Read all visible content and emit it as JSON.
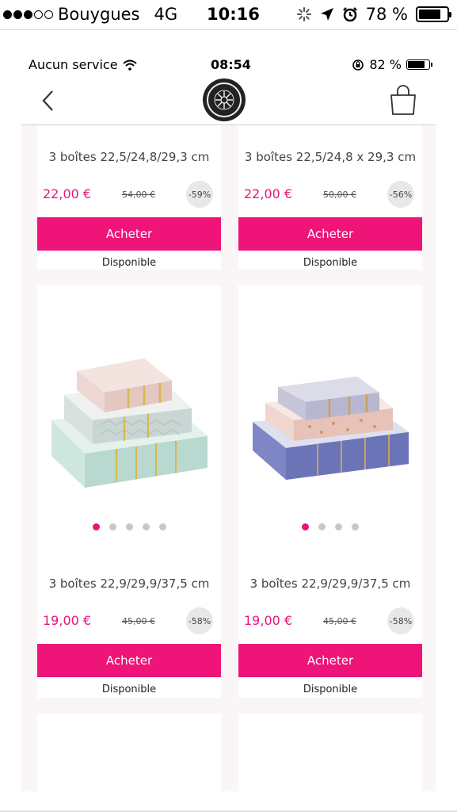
{
  "outer_status": {
    "carrier": "Bouygues",
    "network": "4G",
    "time": "10:16",
    "battery": "78 %",
    "battery_level": 0.78
  },
  "inner_status": {
    "service": "Aucun service",
    "time": "08:54",
    "battery": "82 %",
    "battery_level": 0.82
  },
  "header": {
    "back_icon": "chevron-left-icon",
    "logo": "brand-logo",
    "cart_icon": "shopping-bag-icon"
  },
  "colors": {
    "accent": "#ee1478",
    "price": "#e6157c",
    "page_bg": "#faf6f7"
  },
  "products": [
    {
      "name": "3 boîtes 22,5/24,8/29,3 cm",
      "price": "22,00 €",
      "old_price": "54,00 €",
      "discount": "-59%",
      "buy_label": "Acheter",
      "availability": "Disponible"
    },
    {
      "name": "3 boîtes 22,5/24,8 x 29,3 cm",
      "price": "22,00 €",
      "old_price": "50,00 €",
      "discount": "-56%",
      "buy_label": "Acheter",
      "availability": "Disponible"
    },
    {
      "name": "3 boîtes 22,9/29,9/37,5 cm",
      "price": "19,00 €",
      "old_price": "45,00 €",
      "discount": "-58%",
      "buy_label": "Acheter",
      "availability": "Disponible",
      "image_count": 5,
      "active_image": 1
    },
    {
      "name": "3 boîtes 22,9/29,9/37,5 cm",
      "price": "19,00 €",
      "old_price": "45,00 €",
      "discount": "-58%",
      "buy_label": "Acheter",
      "availability": "Disponible",
      "image_count": 4,
      "active_image": 1
    }
  ]
}
